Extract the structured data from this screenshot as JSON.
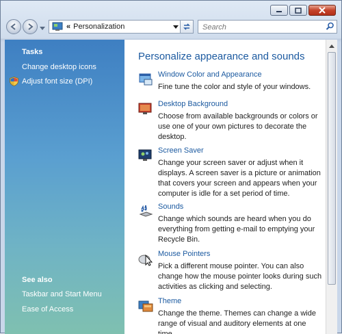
{
  "window": {
    "title_controls": [
      "minimize",
      "maximize",
      "close"
    ]
  },
  "toolbar": {
    "back_icon": "back-arrow-icon",
    "forward_icon": "forward-arrow-icon",
    "address_chevron": "«",
    "address_text": "Personalization",
    "search_placeholder": "Search"
  },
  "sidebar": {
    "tasks_heading": "Tasks",
    "tasks": [
      {
        "label": "Change desktop icons"
      },
      {
        "label": "Adjust font size (DPI)"
      }
    ],
    "see_also_heading": "See also",
    "see_also": [
      {
        "label": "Taskbar and Start Menu"
      },
      {
        "label": "Ease of Access"
      }
    ]
  },
  "content": {
    "heading": "Personalize appearance and sounds",
    "items": [
      {
        "title": "Window Color and Appearance",
        "desc": "Fine tune the color and style of your windows."
      },
      {
        "title": "Desktop Background",
        "desc": "Choose from available backgrounds or colors or use one of your own pictures to decorate the desktop."
      },
      {
        "title": "Screen Saver",
        "desc": "Change your screen saver or adjust when it displays. A screen saver is a picture or animation that covers your screen and appears when your computer is idle for a set period of time."
      },
      {
        "title": "Sounds",
        "desc": "Change which sounds are heard when you do everything from getting e-mail to emptying your Recycle Bin."
      },
      {
        "title": "Mouse Pointers",
        "desc": "Pick a different mouse pointer. You can also change how the mouse pointer looks during such activities as clicking and selecting."
      },
      {
        "title": "Theme",
        "desc": "Change the theme. Themes can change a wide range of visual and auditory elements at one time"
      }
    ]
  },
  "colors": {
    "link": "#1c5aa0",
    "sidebar_top": "#3e7fc2",
    "sidebar_bottom": "#7fc0b0"
  }
}
